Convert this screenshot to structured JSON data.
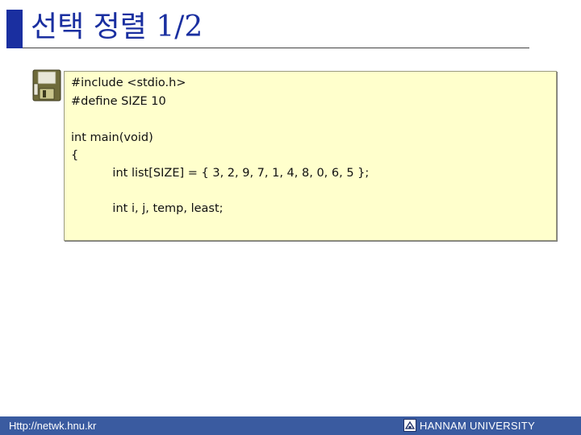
{
  "header": {
    "title": "선택 정렬 1/2"
  },
  "code": {
    "icon": "floppy-disk-icon",
    "lines": [
      "#include <stdio.h>",
      "#define SIZE 10",
      "",
      "int main(void)",
      "{",
      "    int list[SIZE] = { 3, 2, 9, 7, 1, 4, 8, 0, 6, 5 };",
      "",
      "    int i, j, temp, least;"
    ]
  },
  "footer": {
    "url": "Http://netwk.hnu.kr",
    "logo_icon": "hannam-university-emblem-icon",
    "university": "HANNAM  UNIVERSITY"
  },
  "colors": {
    "accent": "#1a2fa0",
    "code_background": "#ffffcc",
    "footer_background": "#3a5ba0"
  }
}
